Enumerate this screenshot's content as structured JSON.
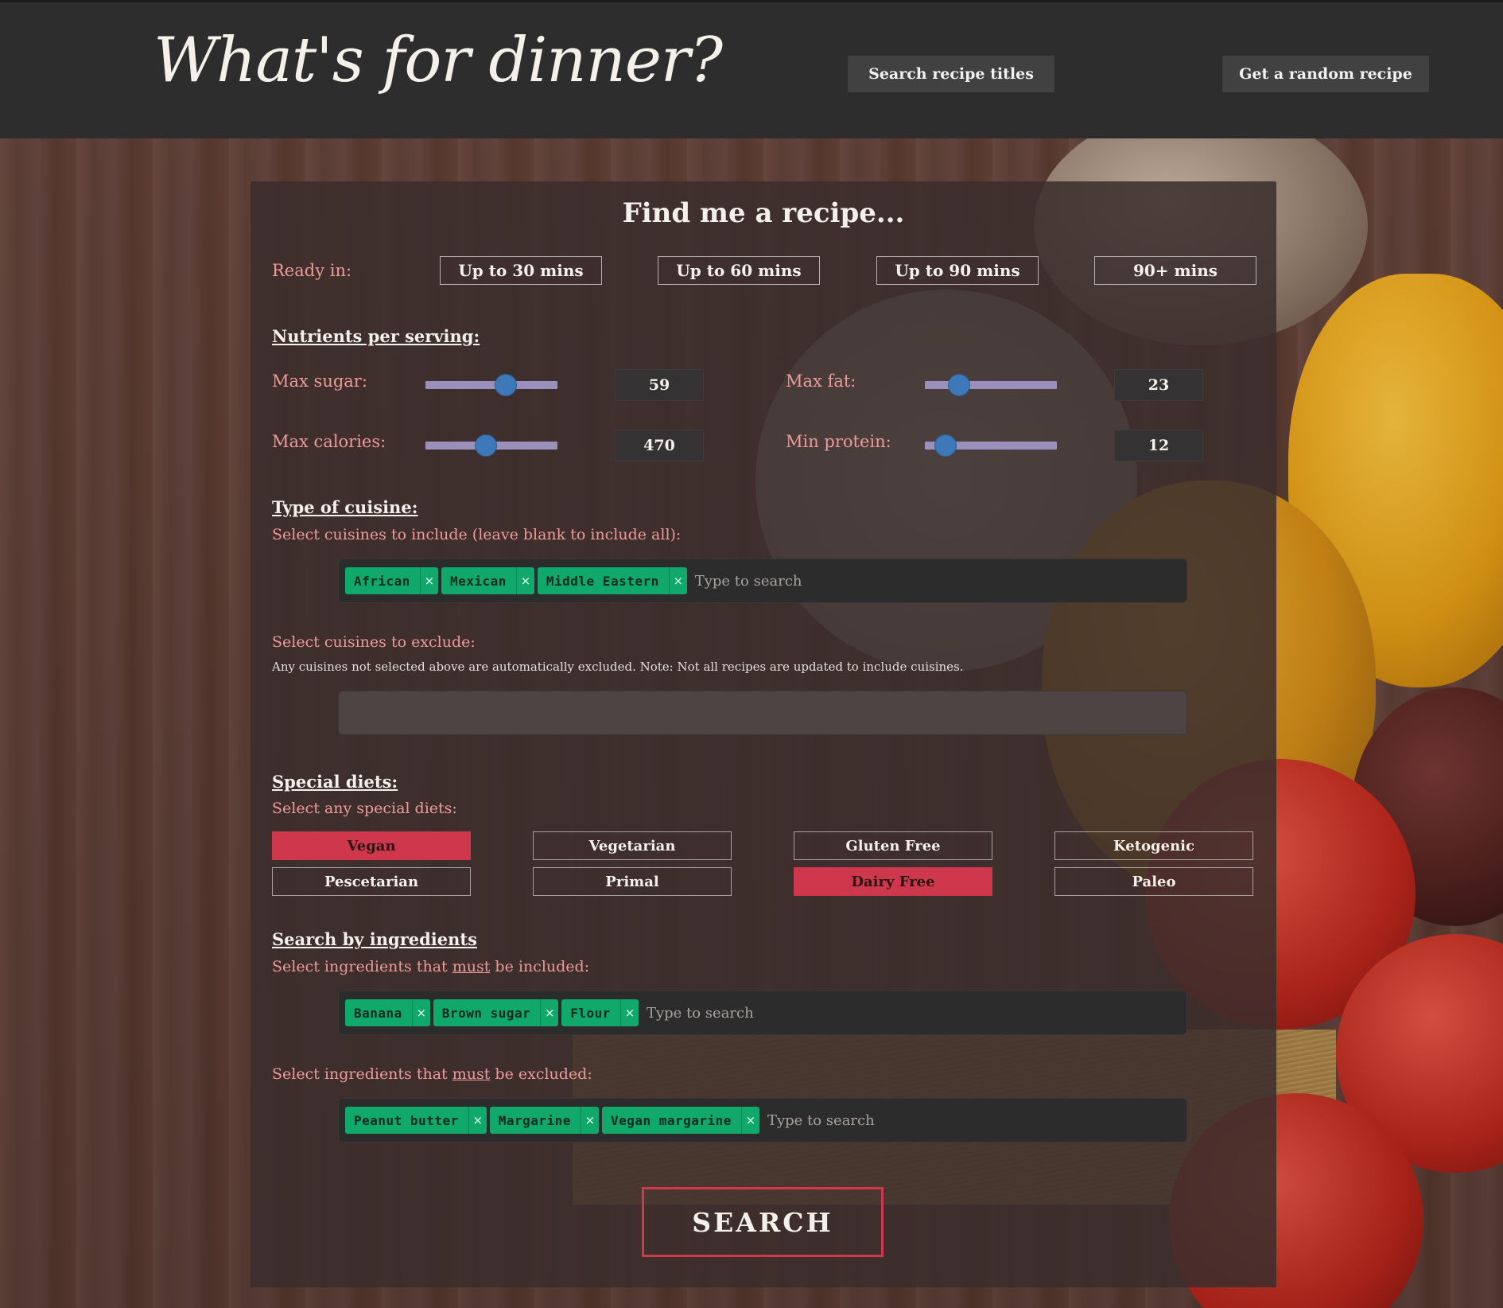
{
  "header": {
    "brand": "What's for dinner?",
    "search_titles": "Search recipe titles",
    "random_recipe": "Get a random recipe"
  },
  "panel": {
    "title": "Find me a recipe...",
    "ready_in_label": "Ready in:",
    "ready_options": [
      "Up to 30 mins",
      "Up to 60 mins",
      "Up to 90 mins",
      "90+ mins"
    ],
    "nutrients_heading": "Nutrients per serving:",
    "sliders": {
      "max_sugar": {
        "label": "Max sugar:",
        "value": "59",
        "fraction": 0.6
      },
      "max_fat": {
        "label": "Max fat:",
        "value": "23",
        "fraction": 0.25
      },
      "max_calories": {
        "label": "Max calories:",
        "value": "470",
        "fraction": 0.45
      },
      "min_protein": {
        "label": "Min protein:",
        "value": "12",
        "fraction": 0.15
      }
    },
    "cuisine_heading": "Type of cuisine:",
    "cuisine_include_label": "Select cuisines to include (leave blank to include all):",
    "cuisine_include_tags": [
      "African",
      "Mexican",
      "Middle Eastern"
    ],
    "cuisine_exclude_label": "Select cuisines to exclude:",
    "cuisine_exclude_note": "Any cuisines not selected above are automatically excluded. Note: Not all recipes are updated to include cuisines.",
    "placeholder": "Type to search",
    "diets_heading": "Special diets:",
    "diets_label": "Select any special diets:",
    "diets": [
      {
        "label": "Vegan",
        "selected": true
      },
      {
        "label": "Vegetarian",
        "selected": false
      },
      {
        "label": "Gluten Free",
        "selected": false
      },
      {
        "label": "Ketogenic",
        "selected": false
      },
      {
        "label": "Pescetarian",
        "selected": false
      },
      {
        "label": "Primal",
        "selected": false
      },
      {
        "label": "Dairy Free",
        "selected": true
      },
      {
        "label": "Paleo",
        "selected": false
      }
    ],
    "ingredients_heading": "Search by ingredients",
    "include_prefix": "Select ingredients that ",
    "must": "must",
    "include_suffix": " be included:",
    "exclude_prefix": "Select ingredients that ",
    "exclude_suffix": " be excluded:",
    "ingredient_include_tags": [
      "Banana",
      "Brown sugar",
      "Flour"
    ],
    "ingredient_exclude_tags": [
      "Peanut butter",
      "Margarine",
      "Vegan margarine"
    ],
    "search_button": "SEARCH",
    "remove_glyph": "×"
  },
  "colors": {
    "tag_green": "#10a86b",
    "diet_selected": "#cf384c",
    "label_pink": "#ef9a9a",
    "header_bg": "#2e2d2d"
  }
}
